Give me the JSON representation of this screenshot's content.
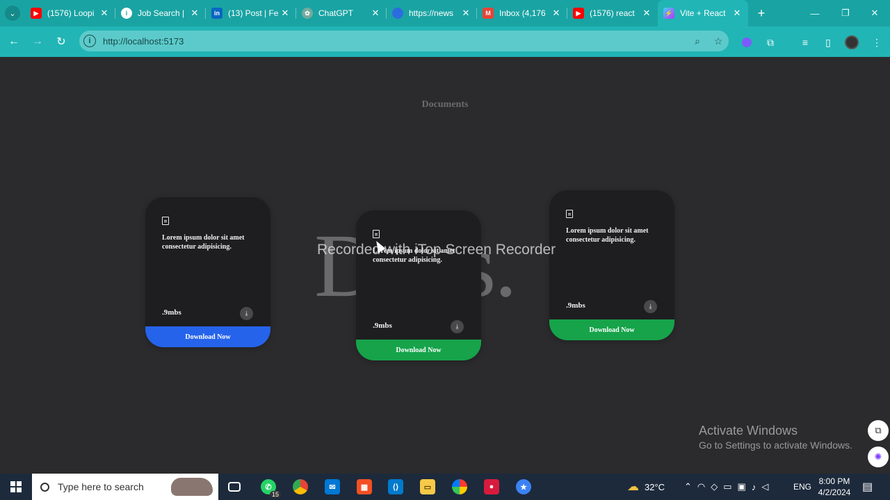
{
  "browser": {
    "tabs": [
      {
        "title": "(1576) Loopi",
        "favicon": "youtube-icon",
        "color": "#ff0000"
      },
      {
        "title": "Job Search |",
        "favicon": "info-icon",
        "color": "#ffffff"
      },
      {
        "title": "(13) Post | Fe",
        "favicon": "linkedin-icon",
        "color": "#0a66c2"
      },
      {
        "title": "ChatGPT",
        "favicon": "chatgpt-icon",
        "color": "#74aa9c"
      },
      {
        "title": "https://news",
        "favicon": "globe-icon",
        "color": "#2d6cdf"
      },
      {
        "title": "Inbox (4,176",
        "favicon": "gmail-icon",
        "color": "#ea4335"
      },
      {
        "title": "(1576) react",
        "favicon": "youtube-icon",
        "color": "#ff0000"
      },
      {
        "title": "Vite + React",
        "favicon": "vite-icon",
        "color": "#bd34fe",
        "active": true
      }
    ],
    "url": "http://localhost:5173",
    "theme_color": "#22b5b5"
  },
  "page": {
    "title": "Documents",
    "background_text": "Docs."
  },
  "cards": [
    {
      "description": "Lorem ipsum dolor sit amet consectetur adipisicing.",
      "size": ".9mbs",
      "button_label": "Download Now",
      "button_color": "#2563eb"
    },
    {
      "description": "Lorem ipsum dolor sit amet consectetur adipisicing.",
      "size": ".9mbs",
      "button_label": "Download Now",
      "button_color": "#16a34a"
    },
    {
      "description": "Lorem ipsum dolor sit amet consectetur adipisicing.",
      "size": ".9mbs",
      "button_label": "Download Now",
      "button_color": "#16a34a"
    }
  ],
  "overlay": {
    "recorder_watermark": "Recorded with iTop Screen Recorder"
  },
  "activation": {
    "title": "Activate Windows",
    "subtitle": "Go to Settings to activate Windows."
  },
  "taskbar": {
    "search_placeholder": "Type here to search",
    "whatsapp_badge": "15",
    "weather": "32°C",
    "language": "ENG",
    "time": "8:00 PM",
    "date": "4/2/2024"
  }
}
